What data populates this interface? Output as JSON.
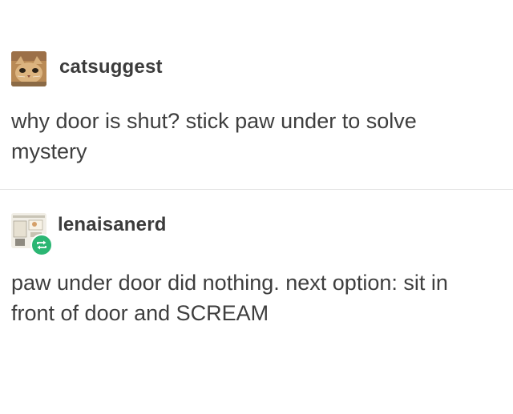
{
  "posts": [
    {
      "username": "catsuggest",
      "avatar_icon": "cat-face-icon",
      "body_lines": [
        "why door is shut? stick paw under to solve",
        "mystery"
      ]
    },
    {
      "username": "lenaisanerd",
      "avatar_icon": "collage-avatar-icon",
      "reblog_icon": "reblog-icon",
      "body_lines": [
        "paw under door did nothing. next option: sit in",
        "front of door and SCREAM"
      ]
    }
  ],
  "colors": {
    "text": "#3e3e3e",
    "divider": "#e3e3e3",
    "reblog_badge": "#2bb673",
    "background": "#ffffff"
  }
}
